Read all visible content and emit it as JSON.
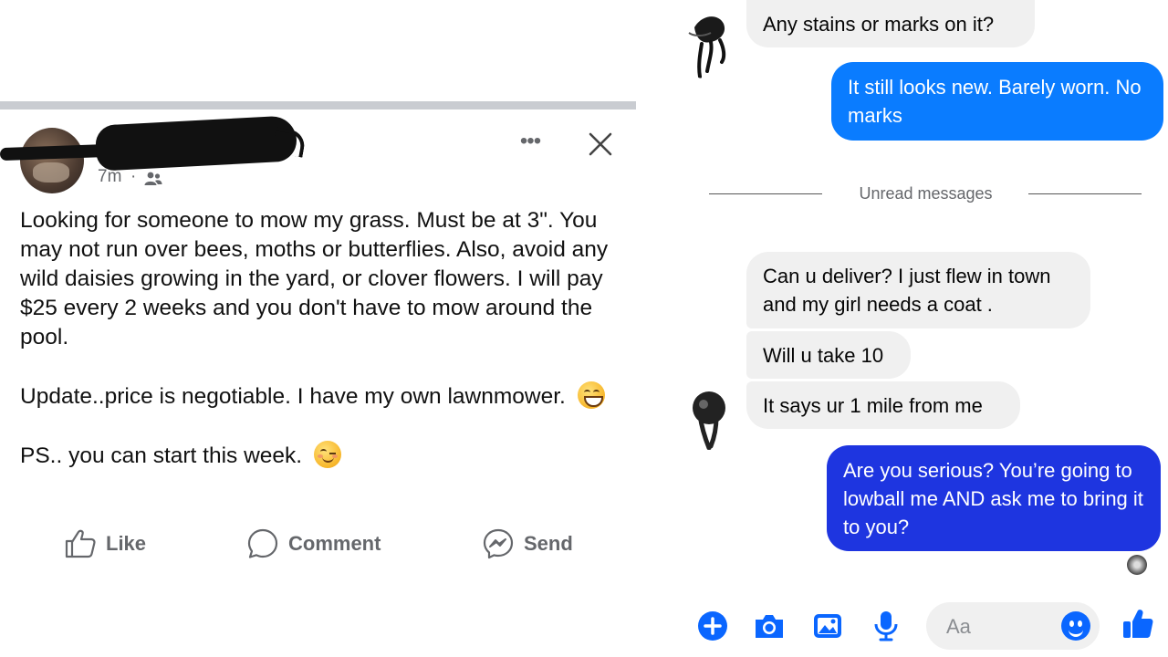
{
  "post": {
    "time": "7m",
    "separator": "·",
    "paragraphs": [
      "Looking for someone to mow my grass. Must be at 3\". You may not run over bees, moths or butterflies. Also, avoid any wild daisies growing in the yard, or clover flowers. I will pay $25 every 2 weeks and you don't have to mow around the pool.",
      "Update..price is negotiable. I have my own lawnmower.",
      "PS.. you can start this week."
    ],
    "actions": {
      "like": "Like",
      "comment": "Comment",
      "send": "Send"
    },
    "more": "•••"
  },
  "chat": {
    "messages": [
      {
        "text": "Any stains or marks on it?",
        "from": "them"
      },
      {
        "text": "It still looks new. Barely worn. No marks",
        "from": "me"
      },
      {
        "text": "Can u deliver? I just flew in town and my girl needs a coat .",
        "from": "them"
      },
      {
        "text": "Will u take 10",
        "from": "them"
      },
      {
        "text": "It says ur 1 mile from me",
        "from": "them"
      },
      {
        "text": "Are you serious? You’re going to lowball me AND ask me to bring it to you?",
        "from": "me"
      }
    ],
    "unread_label": "Unread messages",
    "composer_placeholder": "Aa"
  },
  "colors": {
    "outgoing": "#0a7cff",
    "outgoing_dark": "#1e35e0",
    "incoming": "#f0f0f0",
    "accent": "#0a66ff"
  }
}
